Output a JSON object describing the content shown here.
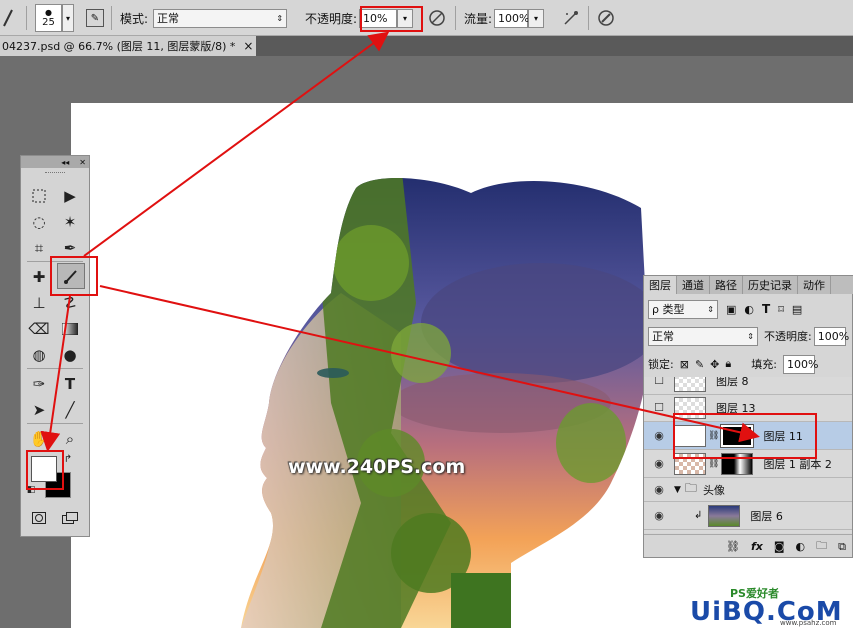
{
  "options_bar": {
    "brush_size": "25",
    "mode_label": "模式:",
    "mode_value": "正常",
    "opacity_label": "不透明度:",
    "opacity_value": "10%",
    "flow_label": "流量:",
    "flow_value": "100%"
  },
  "document_tab": {
    "title": "04237.psd @ 66.7% (图层 11, 图层蒙版/8) *",
    "close": "×"
  },
  "watermark": "www.240PS.com",
  "toolbox": {
    "collapse": "◂◂",
    "close": "✕"
  },
  "layers_panel": {
    "tabs": [
      "图层",
      "通道",
      "路径",
      "历史记录",
      "动作"
    ],
    "filter_label": "ρ 类型",
    "blend_mode": "正常",
    "opacity_label": "不透明度:",
    "opacity_value": "100%",
    "lock_label": "锁定:",
    "fill_label": "填充:",
    "fill_value": "100%",
    "layers": [
      {
        "name": "图层 8",
        "visible": false
      },
      {
        "name": "图层 13",
        "visible": false
      },
      {
        "name": "图层 11",
        "visible": true,
        "selected": true
      },
      {
        "name": "图层 1 副本 2",
        "visible": true
      },
      {
        "name": "头像",
        "visible": true,
        "group": true
      },
      {
        "name": "图层 6",
        "visible": true
      }
    ]
  },
  "logo": {
    "text": "UiBQ.CoM",
    "sub": "PS爱好者",
    "url": "www.psahz.com"
  },
  "colors": {
    "accent_red": "#e01010",
    "selection_blue": "#b7cce6"
  }
}
